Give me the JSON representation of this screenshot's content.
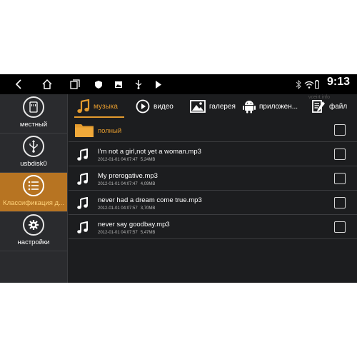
{
  "status_bar": {
    "time": "9:13",
    "nav_icons": [
      "back-icon",
      "home-icon",
      "recent-apps-icon"
    ],
    "notification_icons": [
      "shield-icon",
      "image-icon",
      "usb-icon",
      "play-store-icon"
    ],
    "system_icons": [
      "bluetooth-icon",
      "wifi-icon",
      "battery-icon"
    ]
  },
  "watermark": "vceirt.info",
  "sidebar": {
    "items": [
      {
        "label": "местный",
        "icon": "sd-card-icon",
        "active": false
      },
      {
        "label": "usbdisk0",
        "icon": "usb-icon",
        "active": false
      },
      {
        "label": "Классификация д...",
        "icon": "list-icon",
        "active": true
      },
      {
        "label": "настройки",
        "icon": "gear-icon",
        "active": false
      }
    ]
  },
  "tabs": [
    {
      "label": "музыка",
      "icon": "music-note-icon",
      "active": true
    },
    {
      "label": "видео",
      "icon": "play-circle-icon",
      "active": false
    },
    {
      "label": "галерея",
      "icon": "image-icon",
      "active": false
    },
    {
      "label": "приложен...",
      "icon": "android-icon",
      "active": false
    },
    {
      "label": "файл",
      "icon": "document-edit-icon",
      "active": false
    }
  ],
  "folder_row": {
    "label": "полный",
    "icon": "folder-icon",
    "checked": false
  },
  "files": [
    {
      "name": "I'm not a girl,not yet a woman.mp3",
      "date": "2012-01-01 04:07:47",
      "size": "5,24MB",
      "checked": false
    },
    {
      "name": "My prerogative.mp3",
      "date": "2012-01-01 04:07:47",
      "size": "4,09MB",
      "checked": false
    },
    {
      "name": "never had a dream come true.mp3",
      "date": "2012-01-01 04:07:57",
      "size": "3,70MB",
      "checked": false
    },
    {
      "name": "never say goodbay.mp3",
      "date": "2012-01-01 04:07:57",
      "size": "5,47MB",
      "checked": false
    }
  ],
  "colors": {
    "accent": "#e49b2e",
    "active_sidebar": "#b77422",
    "background": "#1c1d1f",
    "sidebar_bg": "#2a2b2e"
  }
}
